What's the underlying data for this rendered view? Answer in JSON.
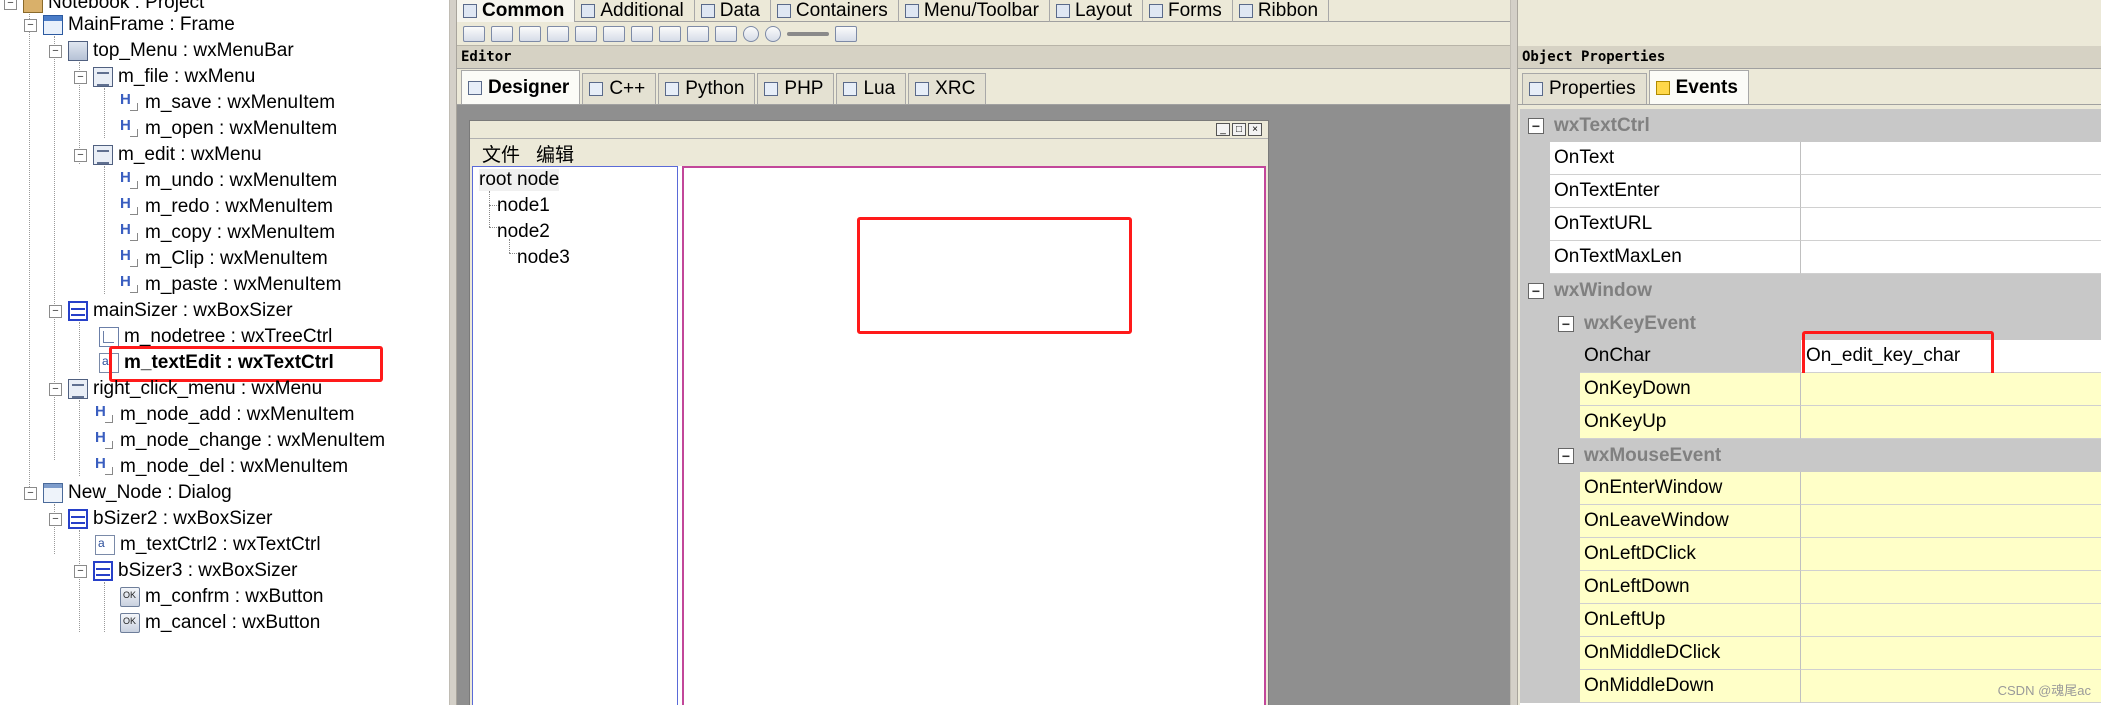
{
  "tree": {
    "rows": [
      {
        "label": "Notebook : Project"
      },
      {
        "label": "MainFrame : Frame"
      },
      {
        "label": "top_Menu : wxMenuBar"
      },
      {
        "label": "m_file : wxMenu"
      },
      {
        "label": "m_save : wxMenuItem"
      },
      {
        "label": "m_open : wxMenuItem"
      },
      {
        "label": "m_edit : wxMenu"
      },
      {
        "label": "m_undo : wxMenuItem"
      },
      {
        "label": "m_redo : wxMenuItem"
      },
      {
        "label": "m_copy : wxMenuItem"
      },
      {
        "label": "m_Clip : wxMenuItem"
      },
      {
        "label": "m_paste : wxMenuItem"
      },
      {
        "label": "mainSizer : wxBoxSizer"
      },
      {
        "label": "m_nodetree : wxTreeCtrl"
      },
      {
        "label": "m_textEdit : wxTextCtrl"
      },
      {
        "label": "right_click_menu : wxMenu"
      },
      {
        "label": "m_node_add : wxMenuItem"
      },
      {
        "label": "m_node_change : wxMenuItem"
      },
      {
        "label": "m_node_del : wxMenuItem"
      },
      {
        "label": "New_Node : Dialog"
      },
      {
        "label": "bSizer2 : wxBoxSizer"
      },
      {
        "label": "m_textCtrl2 : wxTextCtrl"
      },
      {
        "label": "bSizer3 : wxBoxSizer"
      },
      {
        "label": "m_confrm : wxButton"
      },
      {
        "label": "m_cancel : wxButton"
      }
    ]
  },
  "palette": {
    "tabs": [
      "Common",
      "Additional",
      "Data",
      "Containers",
      "Menu/Toolbar",
      "Layout",
      "Forms",
      "Ribbon"
    ]
  },
  "editor": {
    "header": "Editor",
    "tabs": [
      "Designer",
      "C++",
      "Python",
      "PHP",
      "Lua",
      "XRC"
    ],
    "frame": {
      "menus": [
        "文件",
        "编辑"
      ],
      "tree_nodes": [
        "root node",
        "node1",
        "node2",
        "node3"
      ]
    }
  },
  "props": {
    "header": "Object Properties",
    "tabs": [
      "Properties",
      "Events"
    ],
    "rows": [
      {
        "name": "wxTextCtrl",
        "value": ""
      },
      {
        "name": "OnText",
        "value": ""
      },
      {
        "name": "OnTextEnter",
        "value": ""
      },
      {
        "name": "OnTextURL",
        "value": ""
      },
      {
        "name": "OnTextMaxLen",
        "value": ""
      },
      {
        "name": "wxWindow",
        "value": ""
      },
      {
        "name": "wxKeyEvent",
        "value": ""
      },
      {
        "name": "OnChar",
        "value": "On_edit_key_char"
      },
      {
        "name": "OnKeyDown",
        "value": ""
      },
      {
        "name": "OnKeyUp",
        "value": ""
      },
      {
        "name": "wxMouseEvent",
        "value": ""
      },
      {
        "name": "OnEnterWindow",
        "value": ""
      },
      {
        "name": "OnLeaveWindow",
        "value": ""
      },
      {
        "name": "OnLeftDClick",
        "value": ""
      },
      {
        "name": "OnLeftDown",
        "value": ""
      },
      {
        "name": "OnLeftUp",
        "value": ""
      },
      {
        "name": "OnMiddleDClick",
        "value": ""
      },
      {
        "name": "OnMiddleDown",
        "value": ""
      }
    ]
  },
  "colors": {
    "highlight": "#ff1a1a",
    "category_bg": "#c8c8c8",
    "event_yellow": "#ffffc8"
  },
  "watermark": "CSDN @魂尾ac"
}
